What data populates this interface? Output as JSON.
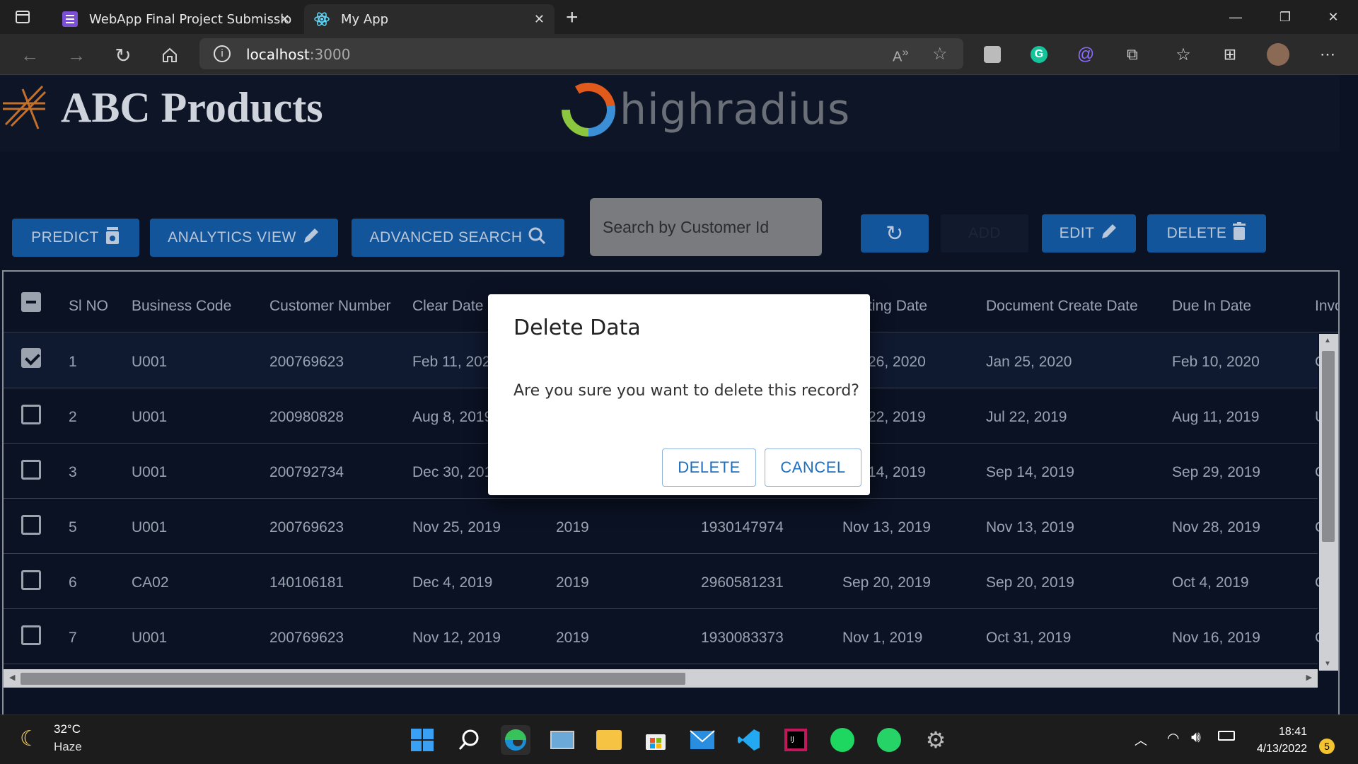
{
  "browser": {
    "tabs": [
      {
        "title": "WebApp Final Project Submissio",
        "icon": "forms-icon"
      },
      {
        "title": "My App",
        "icon": "react-icon"
      }
    ],
    "url_host": "localhost",
    "url_port": ":3000"
  },
  "app": {
    "brand": "ABC Products",
    "partner_logo_text": "highradius"
  },
  "toolbar": {
    "predict": "PREDICT",
    "analytics": "ANALYTICS VIEW",
    "advanced_search": "ADVANCED SEARCH",
    "search_placeholder": "Search by Customer Id",
    "add": "ADD",
    "edit": "EDIT",
    "delete": "DELETE"
  },
  "table": {
    "headers": [
      "Sl NO",
      "Business Code",
      "Customer Number",
      "Clear Date",
      "",
      "",
      "ting Date",
      "Document Create Date",
      "Due In Date",
      "Invo"
    ],
    "rows": [
      {
        "sl": "1",
        "business_code": "U001",
        "customer_number": "200769623",
        "clear_date": "Feb 11, 202",
        "year": "",
        "doc_id": "",
        "posting_date": "26, 2020",
        "create_date": "Jan 25, 2020",
        "due_date": "Feb 10, 2020",
        "inv": "C",
        "checked": true
      },
      {
        "sl": "2",
        "business_code": "U001",
        "customer_number": "200980828",
        "clear_date": "Aug 8, 2019",
        "year": "",
        "doc_id": "",
        "posting_date": "22, 2019",
        "create_date": "Jul 22, 2019",
        "due_date": "Aug 11, 2019",
        "inv": "U",
        "checked": false
      },
      {
        "sl": "3",
        "business_code": "U001",
        "customer_number": "200792734",
        "clear_date": "Dec 30, 201",
        "year": "",
        "doc_id": "",
        "posting_date": "14, 2019",
        "create_date": "Sep 14, 2019",
        "due_date": "Sep 29, 2019",
        "inv": "C",
        "checked": false
      },
      {
        "sl": "5",
        "business_code": "U001",
        "customer_number": "200769623",
        "clear_date": "Nov 25, 2019",
        "year": "2019",
        "doc_id": "1930147974",
        "posting_date": "Nov 13, 2019",
        "create_date": "Nov 13, 2019",
        "due_date": "Nov 28, 2019",
        "inv": "C",
        "checked": false
      },
      {
        "sl": "6",
        "business_code": "CA02",
        "customer_number": "140106181",
        "clear_date": "Dec 4, 2019",
        "year": "2019",
        "doc_id": "2960581231",
        "posting_date": "Sep 20, 2019",
        "create_date": "Sep 20, 2019",
        "due_date": "Oct 4, 2019",
        "inv": "C",
        "checked": false
      },
      {
        "sl": "7",
        "business_code": "U001",
        "customer_number": "200769623",
        "clear_date": "Nov 12, 2019",
        "year": "2019",
        "doc_id": "1930083373",
        "posting_date": "Nov 1, 2019",
        "create_date": "Oct 31, 2019",
        "due_date": "Nov 16, 2019",
        "inv": "C",
        "checked": false
      }
    ]
  },
  "dialog": {
    "title": "Delete Data",
    "message": "Are you sure you want to delete this record?",
    "confirm": "DELETE",
    "cancel": "CANCEL"
  },
  "taskbar": {
    "temperature": "32°C",
    "weather": "Haze",
    "time": "18:41",
    "date": "4/13/2022",
    "notifications": "5"
  },
  "colors": {
    "button_bg": "#13559a",
    "page_bg": "#0b1224",
    "dialog_accent": "#1e6fc0"
  }
}
